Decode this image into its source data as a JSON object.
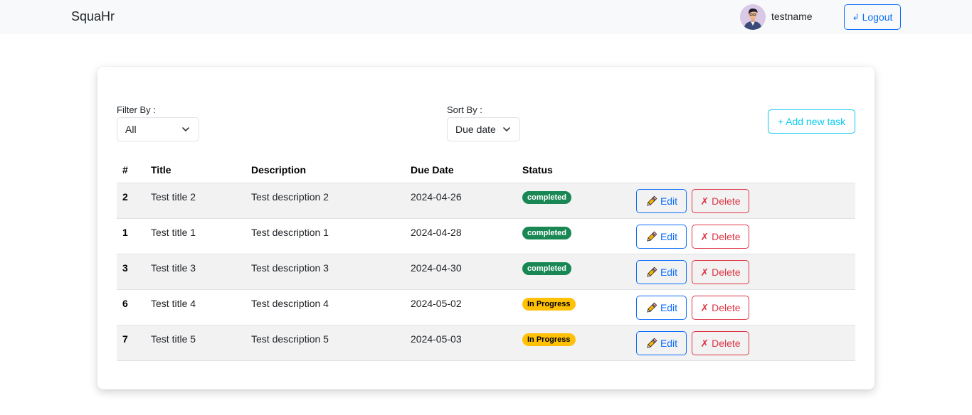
{
  "navbar": {
    "brand": "SquaHr",
    "username": "testname",
    "logout_label": "Logout",
    "logout_icon": "↲"
  },
  "filter": {
    "label": "Filter By :",
    "selected": "All"
  },
  "sort": {
    "label": "Sort By :",
    "selected": "Due date"
  },
  "add_task_label": "+ Add new task",
  "table": {
    "headers": {
      "id": "#",
      "title": "Title",
      "description": "Description",
      "due_date": "Due Date",
      "status": "Status"
    },
    "rows": [
      {
        "id": "2",
        "title": "Test title 2",
        "description": "Test description 2",
        "due_date": "2024-04-26",
        "status": "completed"
      },
      {
        "id": "1",
        "title": "Test title 1",
        "description": "Test description 1",
        "due_date": "2024-04-28",
        "status": "completed"
      },
      {
        "id": "3",
        "title": "Test title 3",
        "description": "Test description 3",
        "due_date": "2024-04-30",
        "status": "completed"
      },
      {
        "id": "6",
        "title": "Test title 4",
        "description": "Test description 4",
        "due_date": "2024-05-02",
        "status": "In Progress"
      },
      {
        "id": "7",
        "title": "Test title 5",
        "description": "Test description 5",
        "due_date": "2024-05-03",
        "status": "In Progress"
      }
    ],
    "edit_label": "Edit",
    "delete_label": "Delete",
    "delete_icon": "✗"
  },
  "colors": {
    "primary": "#0d6efd",
    "danger": "#dc3545",
    "info": "#0dcaf0",
    "success": "#198754",
    "warning": "#ffc107",
    "navbar_bg": "#f8f9fa",
    "stripe": "#f2f2f2"
  },
  "icons": {
    "avatar": "avatar",
    "chevron": "chevron-down-icon",
    "edit": "pencil-icon",
    "delete": "x-mark-icon",
    "logout": "logout-arrow-icon"
  }
}
